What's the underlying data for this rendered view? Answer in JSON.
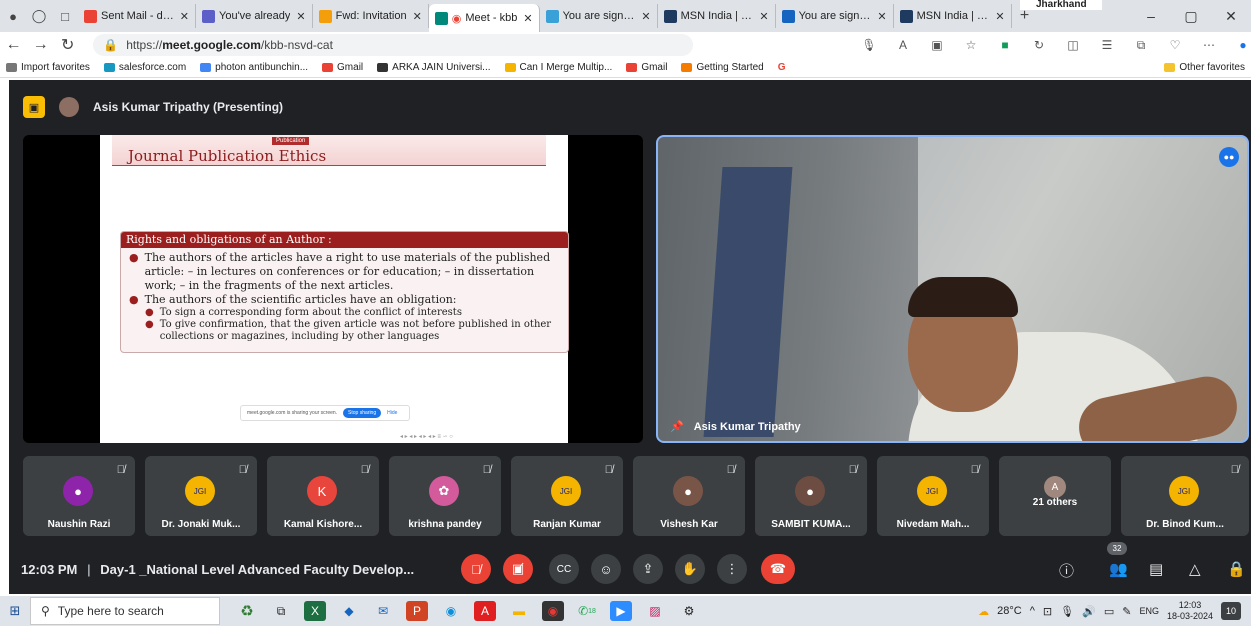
{
  "browser": {
    "tabs": [
      {
        "label": "Sent Mail - dr.b",
        "color": "#ea4335"
      },
      {
        "label": "You've already",
        "color": "#5b5fc7"
      },
      {
        "label": "Fwd: Invitation",
        "color": "#f59e0b"
      },
      {
        "label": "Meet - kbb",
        "color": "#00897b",
        "active": true
      },
      {
        "label": "You are signed",
        "color": "#3aa0d8"
      },
      {
        "label": "MSN India | Bre",
        "color": "#1f3a5f"
      },
      {
        "label": "You are signed",
        "color": "#1565c0"
      },
      {
        "label": "MSN India | Bre",
        "color": "#1f3a5f"
      }
    ],
    "overlay_text": "Jharkhand",
    "url_prefix": "https://",
    "url_domain": "meet.google.com",
    "url_path": "/kbb-nsvd-cat",
    "favorites": [
      {
        "label": "Import favorites",
        "color": "#777"
      },
      {
        "label": "salesforce.com",
        "color": "#1798c1"
      },
      {
        "label": "photon antibunchin...",
        "color": "#4285f4"
      },
      {
        "label": "Gmail",
        "color": "#ea4335"
      },
      {
        "label": "ARKA JAIN Universi...",
        "color": "#333"
      },
      {
        "label": "Can I Merge Multip...",
        "color": "#f4b400"
      },
      {
        "label": "Gmail",
        "color": "#ea4335"
      },
      {
        "label": "Getting Started",
        "color": "#f57c00"
      },
      {
        "label": "G",
        "color": "#ea4335"
      }
    ],
    "other_favorites": "Other favorites"
  },
  "meet": {
    "presenter_label": "Asis Kumar Tripathy (Presenting)",
    "slide": {
      "tag": "Publication",
      "title": "Journal Publication Ethics",
      "box_heading": "Rights and obligations of an Author :",
      "bullet1": "The authors of the articles have a right to use materials of the published article: – in lectures on conferences or for education; – in dissertation work; – in the fragments of the next articles.",
      "bullet2": "The authors of the scientific articles have an obligation:",
      "sub1": "To sign a corresponding form about the conflict of interests",
      "sub2": "To give confirmation, that the given article was not before published in other collections or magazines, including by other languages"
    },
    "sharebar": {
      "text": "meet.google.com is sharing your screen.",
      "stop": "Stop sharing",
      "hide": "Hide"
    },
    "camera_name": "Asis Kumar Tripathy",
    "participants": [
      {
        "name": "Naushin Razi",
        "initial": "",
        "color": "#8e24aa"
      },
      {
        "name": "Dr. Jonaki Muk...",
        "initial": "JGI",
        "color": "#f4b400"
      },
      {
        "name": "Kamal Kishore...",
        "initial": "K",
        "color": "#e8453c"
      },
      {
        "name": "krishna pandey",
        "initial": "",
        "color": "#d35a9b"
      },
      {
        "name": "Ranjan Kumar",
        "initial": "JGI",
        "color": "#f4b400"
      },
      {
        "name": "Vishesh Kar",
        "initial": "",
        "color": "#795548"
      },
      {
        "name": "SAMBIT KUMA...",
        "initial": "",
        "color": "#6d4c41"
      },
      {
        "name": "Nivedam Mah...",
        "initial": "JGI",
        "color": "#f4b400"
      },
      {
        "name": "21 others",
        "initial": "A",
        "color": "#a1887f"
      },
      {
        "name": "Dr. Binod Kum...",
        "initial": "JGI",
        "color": "#f4b400"
      }
    ],
    "time": "12:03 PM",
    "separator": "|",
    "meeting_title": "Day-1 _National Level Advanced Faculty Develop...",
    "participant_count": "32"
  },
  "taskbar": {
    "search_placeholder": "Type here to search",
    "weather": "28°C",
    "lang": "ENG",
    "clock_time": "12:03",
    "clock_date": "18-03-2024",
    "notifications": "10",
    "whatsapp_badge": "18"
  }
}
